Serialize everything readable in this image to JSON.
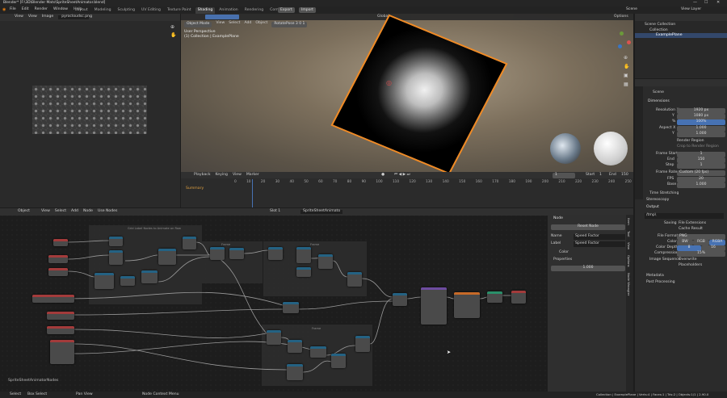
{
  "titlebar": {
    "title": "Blender* [F:\\3D\\Blender Mats\\SpriteSheetAnimator.blend]"
  },
  "menu": [
    "File",
    "Edit",
    "Render",
    "Window",
    "Help"
  ],
  "workspaces": [
    "Layout",
    "Modeling",
    "Sculpting",
    "UV Editing",
    "Texture Paint",
    "Shading",
    "Animation",
    "Rendering",
    "Compositing",
    "Scripting"
  ],
  "active_workspace": "Shading",
  "topbar_buttons": {
    "export": "Export",
    "import": "Import"
  },
  "scene": {
    "name": "Scene",
    "view_layer": "View Layer"
  },
  "image_editor": {
    "menus": [
      "View",
      "View",
      "Image"
    ],
    "image": "pyrocloudsc.png"
  },
  "viewport": {
    "header": [
      "Object Mode",
      "View",
      "Select",
      "Add",
      "Object"
    ],
    "orientation": "Global",
    "options": "Options",
    "perspective": "User Perspective",
    "collection": "(1) Collection | ExamplePlane"
  },
  "header_extra": {
    "shading": "RotatePose 3 0 1"
  },
  "timeline": {
    "menus": [
      "Playback",
      "Keying",
      "View",
      "Marker"
    ],
    "summary": "Summary",
    "current": "1",
    "start_label": "Start",
    "start": "1",
    "end_label": "End",
    "end": "150",
    "ticks": [
      "0",
      "10",
      "20",
      "30",
      "40",
      "50",
      "60",
      "70",
      "80",
      "90",
      "100",
      "110",
      "120",
      "130",
      "140",
      "150",
      "160",
      "170",
      "180",
      "190",
      "200",
      "210",
      "220",
      "230",
      "240",
      "250"
    ]
  },
  "node_editor": {
    "menus": [
      "Object",
      "View",
      "Select",
      "Add",
      "Node"
    ],
    "use_nodes": "Use Nodes",
    "slot": "Slot 1",
    "material": "SpriteSheetAnimato",
    "label": "SpriteSheetAnimatorNodes",
    "frames": [
      "Grid Label Nodes to Animate on Row",
      "Frame",
      "Frame",
      "Frame"
    ]
  },
  "node_panel": {
    "section": "Node",
    "reset": "Reset Node",
    "name_label": "Name",
    "name": "Speed Factor",
    "label_label": "Label",
    "label": "Speed Factor",
    "color": "Color",
    "properties": "Properties",
    "value": "1.000",
    "tabs": [
      "Item",
      "Tool",
      "View",
      "Options",
      "Node Wrangler"
    ]
  },
  "outliner": {
    "items": [
      "Scene Collection",
      "Collection",
      "ExamplePlane"
    ]
  },
  "properties": {
    "title": "Scene",
    "dimensions": "Dimensions",
    "fields": [
      {
        "l": "Resolution X",
        "v": "1920 px"
      },
      {
        "l": "Y",
        "v": "1080 px"
      },
      {
        "l": "%",
        "v": "100%"
      },
      {
        "l": "Aspect X",
        "v": "1.000"
      },
      {
        "l": "Y",
        "v": "1.000"
      }
    ],
    "render_region": "Render Region",
    "crop": "Crop to Render Region",
    "frames": [
      {
        "l": "Frame Start",
        "v": "1"
      },
      {
        "l": "End",
        "v": "150"
      },
      {
        "l": "Step",
        "v": "1"
      }
    ],
    "frame_rate": {
      "l": "Frame Rate",
      "v": "Custom (20 fps)"
    },
    "fps": {
      "l": "FPS",
      "v": "20"
    },
    "base": {
      "l": "Base",
      "v": "1.000"
    },
    "time_stretching": "Time Stretching",
    "stereoscopy": "Stereoscopy",
    "output": "Output",
    "path": "/tmp\\",
    "saving": "Saving",
    "file_ext": "File Extensions",
    "cache": "Cache Result",
    "file_format": "File Format",
    "format": "PNG",
    "color": "Color",
    "bw": "BW",
    "rgb": "RGB",
    "rgba": "RGBA",
    "color_depth": "Color Depth",
    "depth8": "8",
    "depth16": "16",
    "compression": "Compression",
    "comp_val": "15%",
    "image_seq": "Image Sequence",
    "overwrite": "Overwrite",
    "placeholders": "Placeholders",
    "metadata": "Metadata",
    "post": "Post Processing"
  },
  "statusbar": {
    "select": "Select",
    "box": "Box Select",
    "pan": "Pan View",
    "ctx": "Node Context Menu",
    "stats": "Collection | ExamplePlane | Verts:4 | Faces:1 | Tris:2 | Objects:1/1 | 2.90.0"
  }
}
